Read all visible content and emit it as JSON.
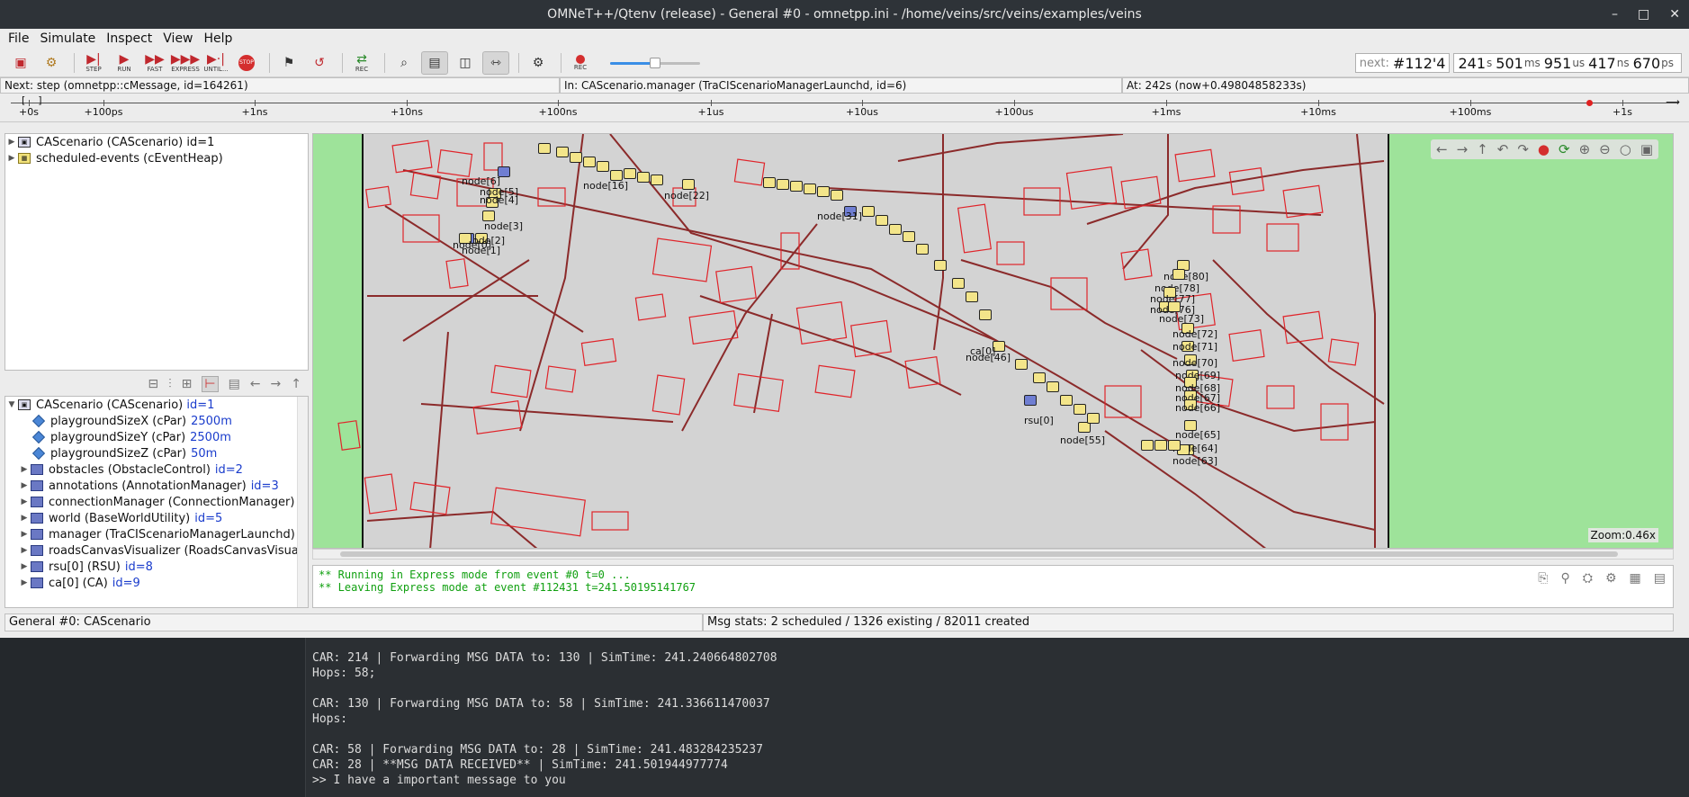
{
  "window": {
    "title": "OMNeT++/Qtenv (release) - General #0 - omnetpp.ini - /home/veins/src/veins/examples/veins",
    "minimize": "–",
    "maximize": "□",
    "close": "✕"
  },
  "menu": [
    "File",
    "Simulate",
    "Inspect",
    "View",
    "Help"
  ],
  "toolbar": {
    "step": "STEP",
    "run": "RUN",
    "fast": "FAST",
    "express": "EXPRESS",
    "until": "UNTIL...",
    "stop": "STOP",
    "rec": "REC",
    "speed_fraction": 0.5,
    "next_label": "next:",
    "next_value": "#112'4",
    "time": {
      "s": "241",
      "ms": "501",
      "us": "951",
      "ns": "417",
      "ps": "670"
    }
  },
  "infobar": {
    "next": "Next: step (omnetpp::cMessage, id=164261)",
    "in": "In: CAScenario.manager (TraCIScenarioManagerLaunchd, id=6)",
    "at": "At: 242s (now+0.49804858233s)"
  },
  "timeline": {
    "labels": [
      "+0s",
      "+100ps",
      "+1ns",
      "+10ns",
      "+100ns",
      "+1us",
      "+10us",
      "+100us",
      "+1ms",
      "+10ms",
      "+100ms",
      "+1s"
    ]
  },
  "left_tree": [
    {
      "label": "CAScenario (CAScenario) id=1",
      "icon": "module"
    },
    {
      "label": "scheduled-events (cEventHeap)",
      "icon": "heap"
    }
  ],
  "object_tree": {
    "root": {
      "name": "CAScenario (CAScenario)",
      "id": "id=1"
    },
    "items": [
      {
        "name": "playgroundSizeX (cPar)",
        "value": "2500m",
        "kind": "par"
      },
      {
        "name": "playgroundSizeY (cPar)",
        "value": "2500m",
        "kind": "par"
      },
      {
        "name": "playgroundSizeZ (cPar)",
        "value": "50m",
        "kind": "par"
      },
      {
        "name": "obstacles (ObstacleControl)",
        "value": "id=2",
        "kind": "mod"
      },
      {
        "name": "annotations (AnnotationManager)",
        "value": "id=3",
        "kind": "mod"
      },
      {
        "name": "connectionManager (ConnectionManager)",
        "value": "",
        "kind": "mod"
      },
      {
        "name": "world (BaseWorldUtility)",
        "value": "id=5",
        "kind": "mod"
      },
      {
        "name": "manager (TraCIScenarioManagerLaunchd)",
        "value": "",
        "kind": "mod"
      },
      {
        "name": "roadsCanvasVisualizer (RoadsCanvasVisua",
        "value": "",
        "kind": "mod"
      },
      {
        "name": "rsu[0] (RSU)",
        "value": "id=8",
        "kind": "mod"
      },
      {
        "name": "ca[0] (CA)",
        "value": "id=9",
        "kind": "mod"
      }
    ]
  },
  "canvas": {
    "zoom": "Zoom:0.46x",
    "nodes": [
      {
        "label": "node[6]"
      },
      {
        "label": "node[5]"
      },
      {
        "label": "node[4]"
      },
      {
        "label": "node[3]"
      },
      {
        "label": "node[2]"
      },
      {
        "label": "node[1]"
      },
      {
        "label": "node[0]"
      },
      {
        "label": "node[16]"
      },
      {
        "label": "node[22]"
      },
      {
        "label": "node[31]"
      },
      {
        "label": "node[46]"
      },
      {
        "label": "ca[0]"
      },
      {
        "label": "node[55]"
      },
      {
        "label": "rsu[0]"
      },
      {
        "label": "node[80]"
      },
      {
        "label": "node[78]"
      },
      {
        "label": "node[77]"
      },
      {
        "label": "node[76]"
      },
      {
        "label": "node[73]"
      },
      {
        "label": "node[72]"
      },
      {
        "label": "node[71]"
      },
      {
        "label": "node[70]"
      },
      {
        "label": "node[69]"
      },
      {
        "label": "node[68]"
      },
      {
        "label": "node[67]"
      },
      {
        "label": "node[66]"
      },
      {
        "label": "node[65]"
      },
      {
        "label": "node[64]"
      },
      {
        "label": "node[63]"
      }
    ]
  },
  "log": [
    "** Running in Express mode from event #0  t=0 ...",
    "** Leaving Express mode at event #112431  t=241.50195141767"
  ],
  "status": {
    "left": "General #0: CAScenario",
    "right": "Msg stats: 2 scheduled / 1326 existing / 82011 created"
  },
  "terminal": [
    "CAR: 214 | Forwarding MSG DATA to: 130 | SimTime: 241.240664802708",
    "Hops: 58;",
    "",
    "CAR: 130 | Forwarding MSG DATA to: 58 | SimTime: 241.336611470037",
    "Hops:",
    "",
    "CAR: 58 | Forwarding MSG DATA to: 28 | SimTime: 241.483284235237",
    "CAR: 28 | **MSG DATA RECEIVED** | SimTime: 241.501944977774",
    ">> I have a important message to you"
  ],
  "colors": {
    "map_bg": "#d3d3d3",
    "park": "#9ee39a",
    "road": "#8b2a2a",
    "building": "#e0242a",
    "log_green": "#10a010"
  }
}
